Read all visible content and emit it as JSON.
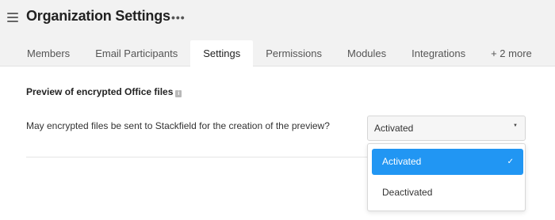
{
  "header": {
    "title": "Organization Settings",
    "menu_icon": "hamburger-menu-icon",
    "more_icon": "more-horizontal-icon",
    "more_glyph": "•••"
  },
  "tabs": [
    {
      "label": "Members",
      "active": false
    },
    {
      "label": "Email Participants",
      "active": false
    },
    {
      "label": "Settings",
      "active": true
    },
    {
      "label": "Permissions",
      "active": false
    },
    {
      "label": "Modules",
      "active": false
    },
    {
      "label": "Integrations",
      "active": false
    },
    {
      "label": "+ 2 more",
      "active": false
    }
  ],
  "section": {
    "title": "Preview of encrypted Office files",
    "info_icon": "info-icon",
    "question": "May encrypted files be sent to Stackfield for the creation of the preview?"
  },
  "select": {
    "value": "Activated",
    "caret_icon": "caret-down-icon",
    "options": [
      {
        "label": "Activated",
        "selected": true
      },
      {
        "label": "Deactivated",
        "selected": false
      }
    ]
  },
  "colors": {
    "accent": "#2196f3",
    "header_bg": "#f2f2f2"
  }
}
